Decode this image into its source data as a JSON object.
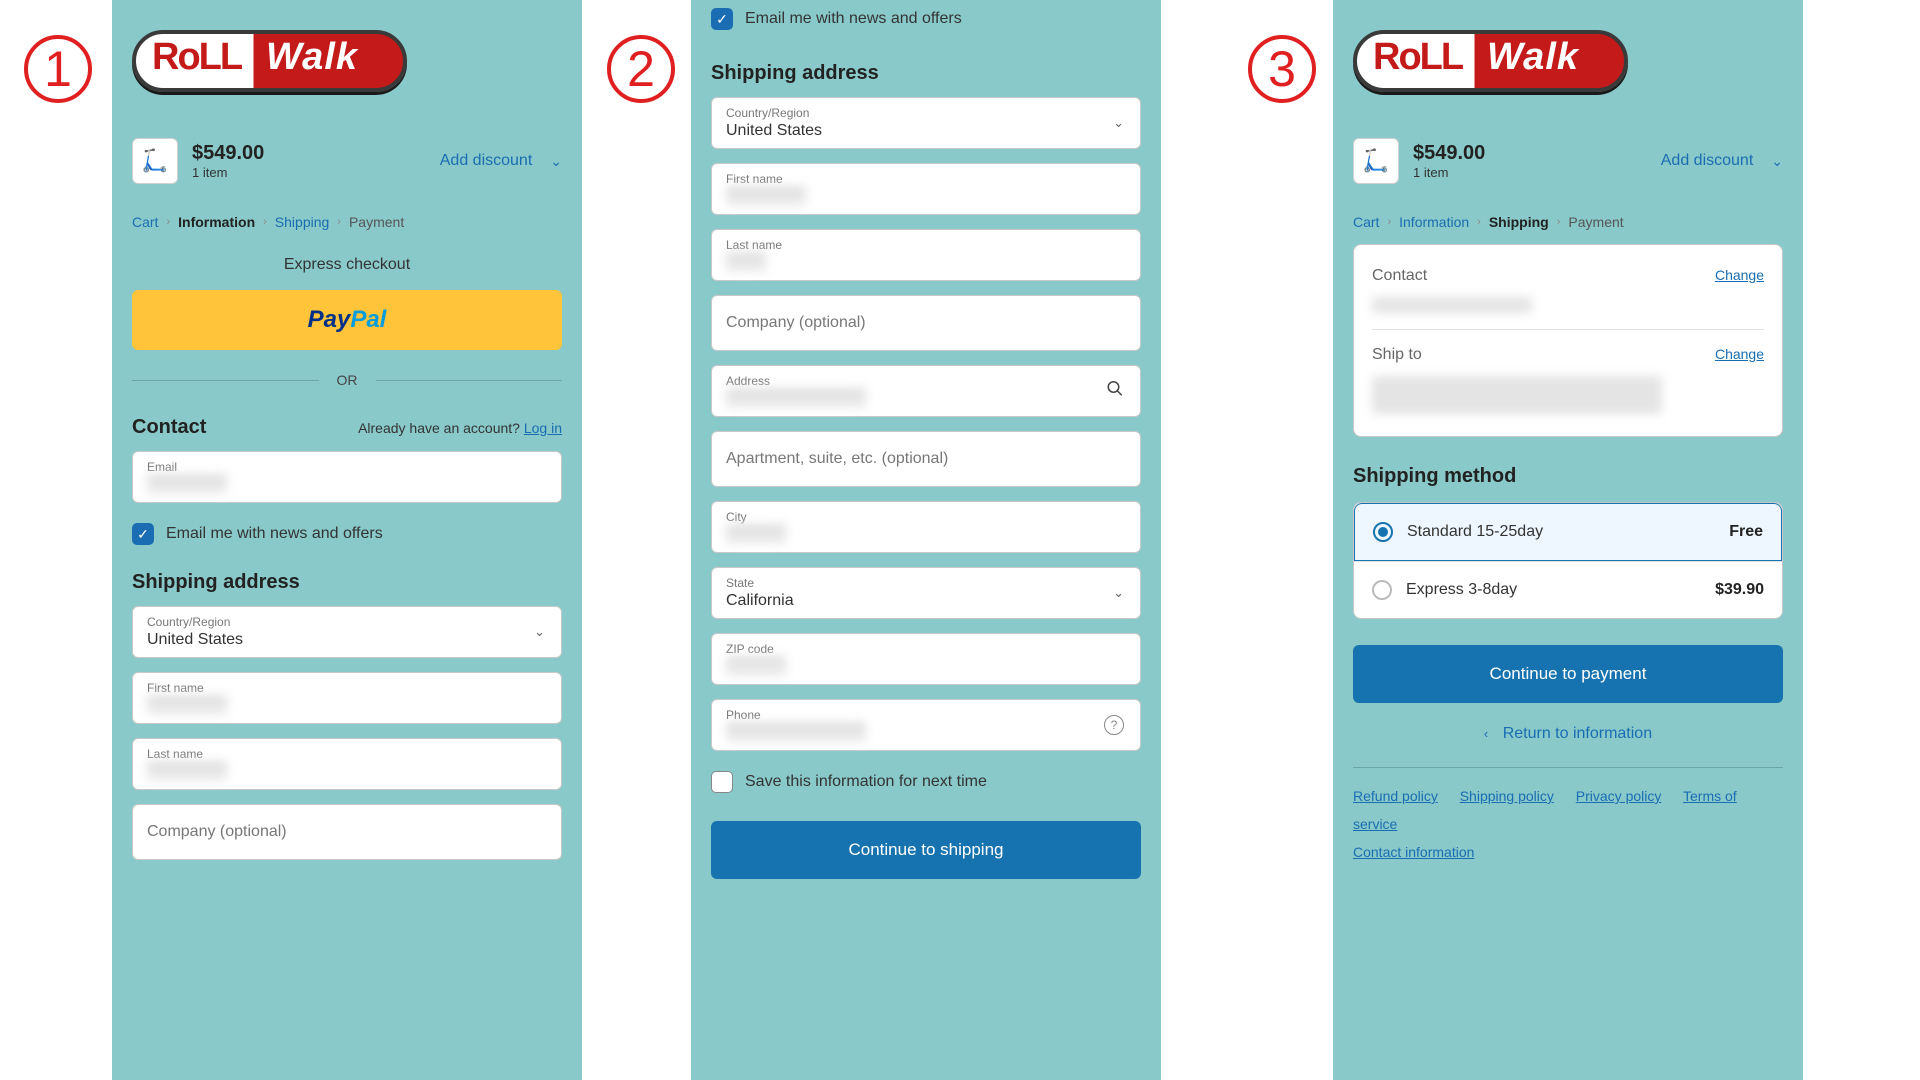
{
  "badges": {
    "b1": "1",
    "b2": "2",
    "b3": "3"
  },
  "logo": {
    "roll": "RoLL",
    "walk": "Walk"
  },
  "summary": {
    "price": "$549.00",
    "items": "1 item",
    "add_discount": "Add discount"
  },
  "crumbs": {
    "cart": "Cart",
    "information": "Information",
    "shipping": "Shipping",
    "payment": "Payment"
  },
  "panel1": {
    "express": "Express checkout",
    "paypal_pay": "Pay",
    "paypal_pal": "Pal",
    "or": "OR",
    "contact": "Contact",
    "already": "Already have an account?",
    "login": "Log in",
    "email_label": "Email",
    "news_label": "Email me with news and offers",
    "shipping_address": "Shipping address",
    "country_label": "Country/Region",
    "country_value": "United States",
    "first_name_label": "First name",
    "last_name_label": "Last name",
    "company_placeholder": "Company (optional)"
  },
  "panel2": {
    "news_label": "Email me with news and offers",
    "shipping_address": "Shipping address",
    "country_label": "Country/Region",
    "country_value": "United States",
    "first_name_label": "First name",
    "last_name_label": "Last name",
    "company_placeholder": "Company (optional)",
    "address_label": "Address",
    "apartment_placeholder": "Apartment, suite, etc. (optional)",
    "city_label": "City",
    "state_label": "State",
    "state_value": "California",
    "zip_label": "ZIP code",
    "phone_label": "Phone",
    "save_label": "Save this information for next time",
    "continue": "Continue to shipping"
  },
  "panel3": {
    "contact": "Contact",
    "shipto": "Ship to",
    "change": "Change",
    "method_title": "Shipping method",
    "options": [
      {
        "name": "Standard 15-25day",
        "price": "Free"
      },
      {
        "name": "Express 3-8day",
        "price": "$39.90"
      }
    ],
    "continue": "Continue to payment",
    "return": "Return to information",
    "footer": {
      "refund": "Refund policy",
      "shipping": "Shipping policy",
      "privacy": "Privacy policy",
      "terms": "Terms of service",
      "contact": "Contact information"
    }
  }
}
